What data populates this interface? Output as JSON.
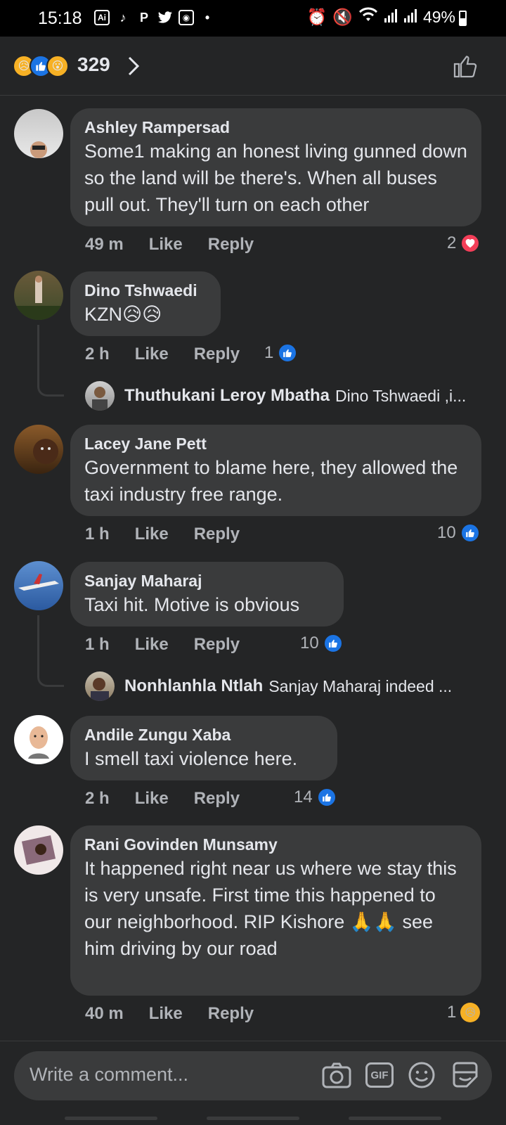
{
  "status_bar": {
    "time": "15:18",
    "battery": "49%",
    "left_icons": [
      "ai-icon",
      "tiktok-icon",
      "pinterest-icon",
      "twitter-icon",
      "camera-app-icon",
      "dot-icon"
    ],
    "right_icons": [
      "alarm-icon",
      "mute-icon",
      "wifi-icon",
      "signal-icon",
      "signal-icon"
    ]
  },
  "header": {
    "reaction_count": "329",
    "reactions": [
      "sad",
      "like",
      "wow"
    ]
  },
  "comments": [
    {
      "author": "Ashley Rampersad",
      "text": "Some1 making an honest living gunned down so the land will be there's. When all buses pull out. They'll turn on each other",
      "time": "49 m",
      "like": "Like",
      "reply": "Reply",
      "reactions": "2",
      "reaction_type": "love"
    },
    {
      "author": "Dino Tshwaedi",
      "text": "KZN😥😥",
      "time": "2 h",
      "like": "Like",
      "reply": "Reply",
      "reactions": "1",
      "reaction_type": "like",
      "reply_preview": {
        "author": "Thuthukani Leroy Mbatha",
        "text": "Dino Tshwaedi ,i..."
      }
    },
    {
      "author": "Lacey Jane Pett",
      "text": "Government to blame here, they allowed the taxi industry free range.",
      "time": "1 h",
      "like": "Like",
      "reply": "Reply",
      "reactions": "10",
      "reaction_type": "like"
    },
    {
      "author": "Sanjay Maharaj",
      "text": "Taxi hit. Motive is obvious",
      "time": "1 h",
      "like": "Like",
      "reply": "Reply",
      "reactions": "10",
      "reaction_type": "like",
      "reply_preview": {
        "author": "Nonhlanhla Ntlah",
        "text": "Sanjay Maharaj indeed ..."
      }
    },
    {
      "author": "Andile Zungu Xaba",
      "text": "I smell taxi violence here.",
      "time": "2 h",
      "like": "Like",
      "reply": "Reply",
      "reactions": "14",
      "reaction_type": "like"
    },
    {
      "author": "Rani Govinden Munsamy",
      "text": "It happened right near us where we stay this is very unsafe. First time this happened to our neighborhood. RIP Kishore 🙏🙏 see him driving by our road",
      "time": "40 m",
      "like": "Like",
      "reply": "Reply",
      "reactions": "1",
      "reaction_type": "sad"
    }
  ],
  "composer": {
    "placeholder": "Write a comment...",
    "gif_label": "GIF"
  },
  "colors": {
    "background": "#242526",
    "bubble": "#3a3b3c",
    "like_blue": "#1b74e4",
    "love_red": "#f33e58",
    "text_primary": "#e4e6eb",
    "text_secondary": "#b0b3b8"
  }
}
